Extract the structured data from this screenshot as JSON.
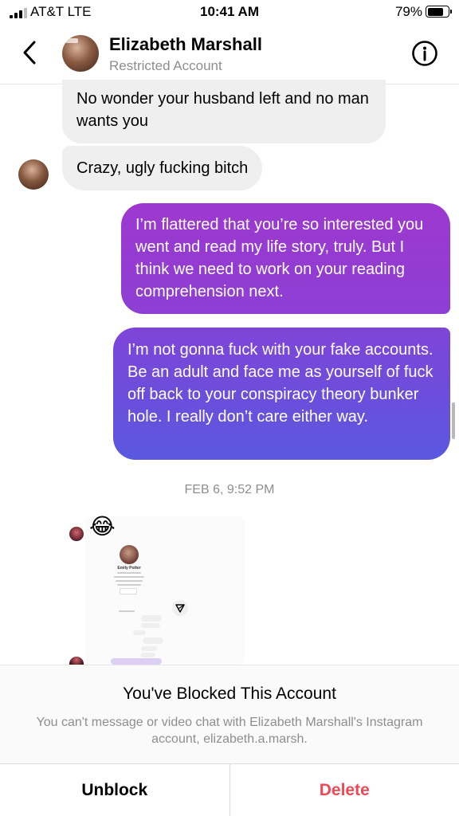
{
  "status_bar": {
    "carrier": "AT&T  LTE",
    "time": "10:41 AM",
    "battery_percent": "79%",
    "battery_level": 0.79
  },
  "header": {
    "contact_name": "Elizabeth Marshall",
    "contact_subtitle": "Restricted Account",
    "back_icon": "chevron-left-icon",
    "info_icon": "info-circle-icon"
  },
  "messages": [
    {
      "direction": "incoming",
      "text": "No wonder your husband left and no man wants you"
    },
    {
      "direction": "incoming",
      "text": "Crazy, ugly fucking bitch"
    },
    {
      "direction": "outgoing",
      "text": "I’m flattered that you’re so interested you went and read my life story, truly. But I think we need to work on your reading comprehension next."
    },
    {
      "direction": "outgoing",
      "text": "I’m not gonna fuck with your fake accounts. Be an adult and face me as yourself of fuck off back to your conspiracy theory bunker hole. I really don’t care either way."
    }
  ],
  "timestamp": "FEB 6, 9:52 PM",
  "reaction_emoji": "😂",
  "shared_post": {
    "profile_name": "Emily Potter",
    "send_icon": "paper-plane-icon"
  },
  "blocked_panel": {
    "title": "You've Blocked This Account",
    "description": "You can't message or video chat with Elizabeth Marshall's Instagram account, elizabeth.a.marsh."
  },
  "actions": {
    "unblock_label": "Unblock",
    "delete_label": "Delete"
  },
  "colors": {
    "delete_red": "#ed4956",
    "bubble_incoming": "#efefef",
    "bubble_out_top": "#9d38cf",
    "bubble_out_bottom": "#5a58df",
    "muted_text": "#8e8e8e"
  }
}
